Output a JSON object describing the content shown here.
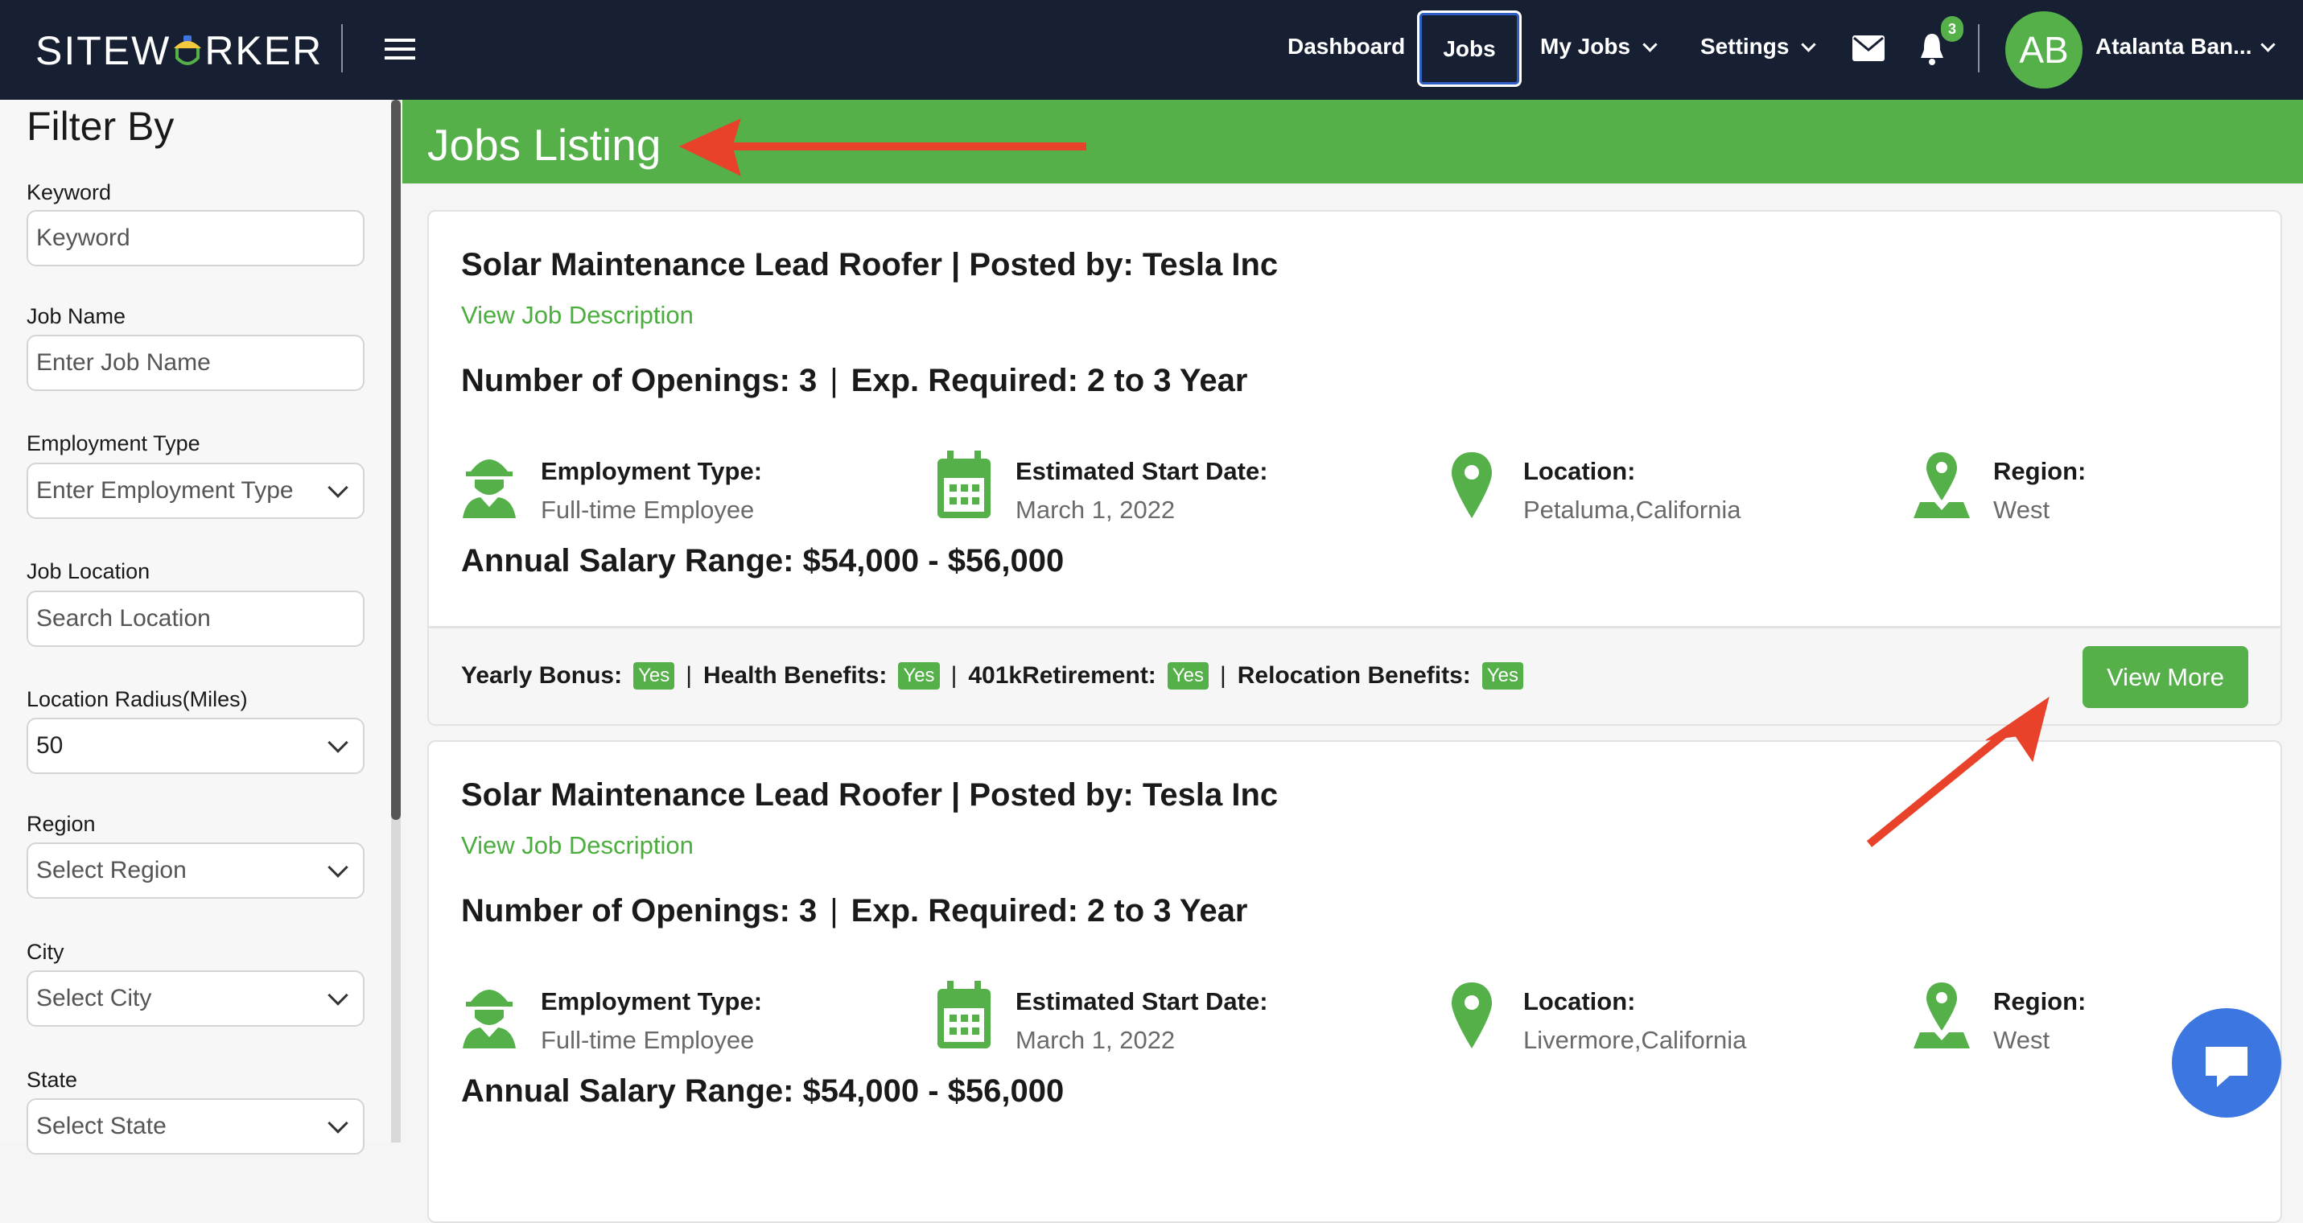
{
  "brand": {
    "logo_text_left": "SITEW",
    "logo_text_right": "RKER",
    "colors": {
      "navbar": "#172033",
      "accent": "#55b04a",
      "arrow": "#e8432a",
      "chat": "#3b76e1"
    }
  },
  "nav": {
    "dashboard": "Dashboard",
    "jobs": "Jobs",
    "my_jobs": "My Jobs",
    "settings": "Settings",
    "notifications_count": "3",
    "avatar_initials": "AB",
    "user_name": "Atalanta Ban..."
  },
  "sidebar": {
    "title": "Filter By",
    "filters": [
      {
        "label": "Keyword",
        "placeholder": "Keyword"
      },
      {
        "label": "Job Name",
        "placeholder": "Enter Job Name"
      },
      {
        "label": "Employment Type",
        "placeholder": "Enter Employment Type"
      },
      {
        "label": "Job Location",
        "placeholder": "Search Location"
      },
      {
        "label": "Location Radius(Miles)",
        "value": "50"
      },
      {
        "label": "Region",
        "placeholder": "Select Region"
      },
      {
        "label": "City",
        "placeholder": "Select City"
      },
      {
        "label": "State",
        "placeholder": "Select State"
      }
    ]
  },
  "page": {
    "title": "Jobs Listing"
  },
  "jobs": [
    {
      "title": "Solar Maintenance Lead Roofer | Posted by: Tesla Inc",
      "link": "View Job Description",
      "openings": "Number of Openings: 3",
      "sep": "|",
      "experience": "Exp. Required: 2 to 3 Year",
      "employment_label": "Employment Type:",
      "employment": "Full-time Employee",
      "start_label": "Estimated Start Date:",
      "start": "March 1, 2022",
      "location_label": "Location:",
      "location": "Petaluma,California",
      "region_label": "Region:",
      "region": "West",
      "salary": "Annual Salary Range: $54,000 - $56,000",
      "benefits": [
        {
          "label": "Yearly Bonus:",
          "value": "Yes"
        },
        {
          "label": "Health Benefits:",
          "value": "Yes"
        },
        {
          "label": "401kRetirement:",
          "value": "Yes"
        },
        {
          "label": "Relocation Benefits:",
          "value": "Yes"
        }
      ],
      "view_more": "View More"
    },
    {
      "title": "Solar Maintenance Lead Roofer | Posted by: Tesla Inc",
      "link": "View Job Description",
      "openings": "Number of Openings: 3",
      "sep": "|",
      "experience": "Exp. Required: 2 to 3 Year",
      "employment_label": "Employment Type:",
      "employment": "Full-time Employee",
      "start_label": "Estimated Start Date:",
      "start": "March 1, 2022",
      "location_label": "Location:",
      "location": "Livermore,California",
      "region_label": "Region:",
      "region": "West",
      "salary": "Annual Salary Range: $54,000 - $56,000"
    }
  ]
}
